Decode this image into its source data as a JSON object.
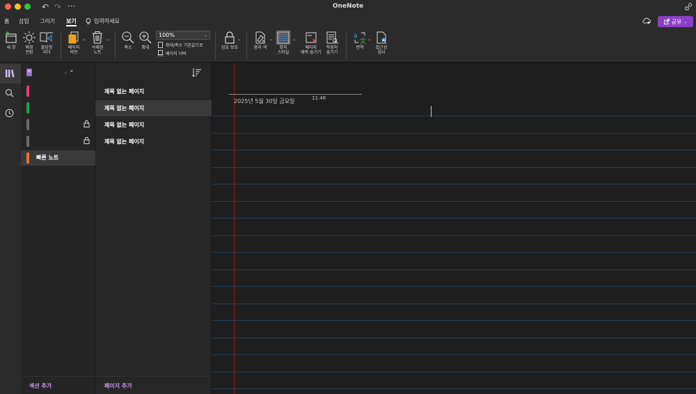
{
  "window": {
    "title": "OneNote"
  },
  "tabs": [
    {
      "label": "홈"
    },
    {
      "label": "삽입"
    },
    {
      "label": "그리기"
    },
    {
      "label": "보기"
    }
  ],
  "active_tab": "보기",
  "tell_me": "입력하세요",
  "share_label": "공유",
  "ribbon": {
    "new_window": "새 창",
    "background": "배경\n전환",
    "immersive_reader": "몰입형\n리더",
    "page_versions": "페이지\n버전",
    "deleted_notes": "삭제된\n노트",
    "zoom_out": "축소",
    "zoom_in": "확대",
    "zoom_value": "100%",
    "zoom_default": "확대/축소 기본값으로",
    "page_width": "페이지 너비",
    "password": "암호 보호",
    "paper_color": "용지 색",
    "paper_style": "용지\n스타일",
    "hide_page_title": "페이지\n제목 숨기기",
    "hide_author": "작성자\n숨기기",
    "translate": "번역",
    "accessibility": "접근성\n검사"
  },
  "notebook": {
    "name": ""
  },
  "sections": [
    {
      "label": "",
      "color": "#e0407b",
      "locked": false
    },
    {
      "label": "",
      "color": "#1fa04a",
      "locked": false
    },
    {
      "label": "",
      "color": "#6b6b6b",
      "locked": true
    },
    {
      "label": "",
      "color": "#6b6b6b",
      "locked": true
    },
    {
      "label": "빠른 노트",
      "color": "#e8741e",
      "locked": false,
      "selected": true
    }
  ],
  "pages": [
    {
      "label": "제목 없는 페이지"
    },
    {
      "label": "제목 없는 페이지",
      "selected": true
    },
    {
      "label": "제목 없는 페이지"
    },
    {
      "label": "제목 없는 페이지"
    }
  ],
  "add_section": "섹션 추가",
  "add_page": "페이지 추가",
  "canvas": {
    "date": "2025년 5월 30일 금요일",
    "time": "11:46"
  },
  "colors": {
    "accent": "#8b3fc6",
    "add_link": "#c49ae6",
    "margin_line": "#8b2222",
    "rule_line": "#263d55"
  }
}
